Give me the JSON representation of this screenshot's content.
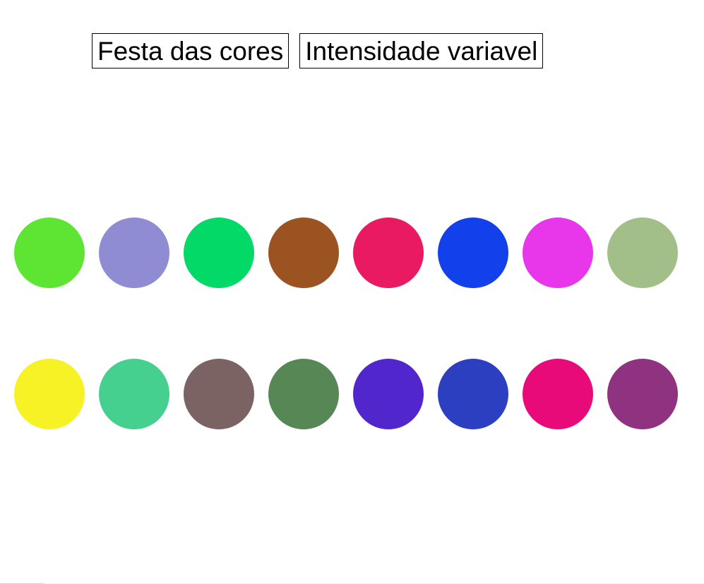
{
  "toolbar": {
    "party_label": "Festa das cores",
    "intensity_label": "Intensidade variavel"
  },
  "circles": {
    "row1": [
      "#5ee534",
      "#8f8cd3",
      "#03d966",
      "#9c5322",
      "#ea1a62",
      "#1240ea",
      "#e837ea",
      "#a2bf8a"
    ],
    "row2": [
      "#f7f226",
      "#46d08f",
      "#7a6362",
      "#568754",
      "#5126cc",
      "#2d3fc1",
      "#e90a7a",
      "#8f3280"
    ]
  }
}
